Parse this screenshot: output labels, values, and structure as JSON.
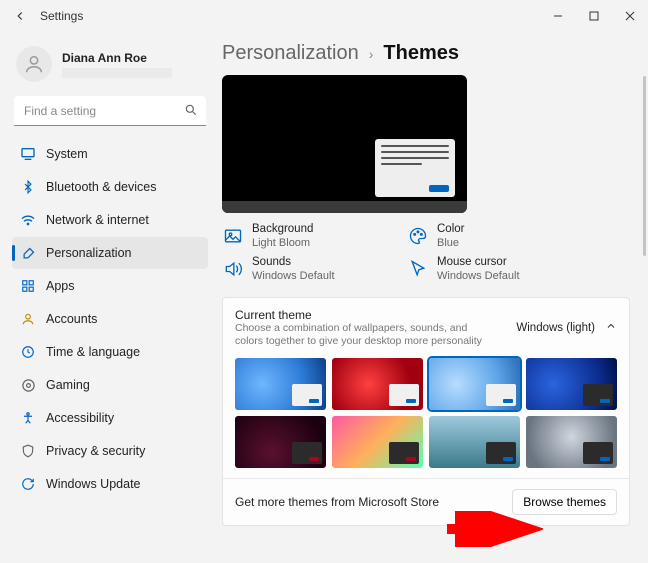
{
  "titlebar": {
    "title": "Settings"
  },
  "user": {
    "name": "Diana Ann Roe"
  },
  "search": {
    "placeholder": "Find a setting"
  },
  "nav": {
    "items": [
      {
        "label": "System"
      },
      {
        "label": "Bluetooth & devices"
      },
      {
        "label": "Network & internet"
      },
      {
        "label": "Personalization"
      },
      {
        "label": "Apps"
      },
      {
        "label": "Accounts"
      },
      {
        "label": "Time & language"
      },
      {
        "label": "Gaming"
      },
      {
        "label": "Accessibility"
      },
      {
        "label": "Privacy & security"
      },
      {
        "label": "Windows Update"
      }
    ]
  },
  "breadcrumb": {
    "parent": "Personalization",
    "sep": "›",
    "current": "Themes"
  },
  "options": {
    "background": {
      "label": "Background",
      "value": "Light Bloom"
    },
    "color": {
      "label": "Color",
      "value": "Blue"
    },
    "sounds": {
      "label": "Sounds",
      "value": "Windows Default"
    },
    "cursor": {
      "label": "Mouse cursor",
      "value": "Windows Default"
    }
  },
  "current_theme": {
    "title": "Current theme",
    "sub": "Choose a combination of wallpapers, sounds, and colors together to give your desktop more personality",
    "value": "Windows (light)"
  },
  "footer": {
    "text": "Get more themes from Microsoft Store",
    "button": "Browse themes"
  }
}
